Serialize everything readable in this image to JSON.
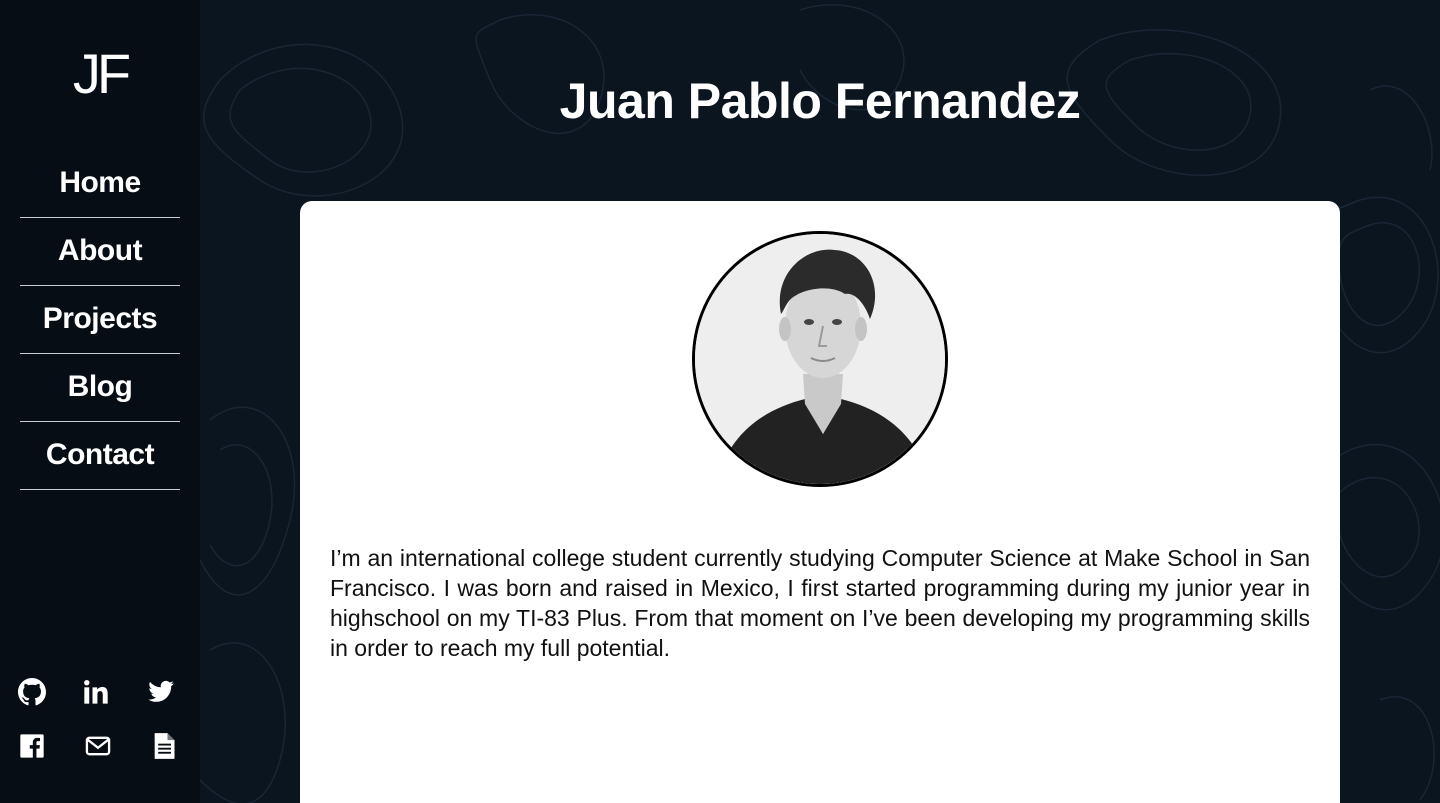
{
  "sidebar": {
    "logo": "JF",
    "nav": [
      {
        "label": "Home"
      },
      {
        "label": "About"
      },
      {
        "label": "Projects"
      },
      {
        "label": "Blog"
      },
      {
        "label": "Contact"
      }
    ],
    "social_icons": [
      "github-icon",
      "linkedin-icon",
      "twitter-icon",
      "facebook-icon",
      "mail-icon",
      "resume-document-icon"
    ]
  },
  "main": {
    "title": "Juan Pablo Fernandez",
    "profile_photo": "profile-photo",
    "bio": "I’m an international college student currently studying Computer Science at Make School in San Francisco. I was born and raised in Mexico, I first started programming during my junior year in highschool on my TI-83 Plus. From that moment on I’ve been developing my programming skills in order to reach my full potential."
  },
  "colors": {
    "sidebar_bg": "#070d14",
    "main_bg": "#0b1520",
    "card_bg": "#ffffff",
    "text_light": "#ffffff",
    "text_dark": "#111111"
  }
}
